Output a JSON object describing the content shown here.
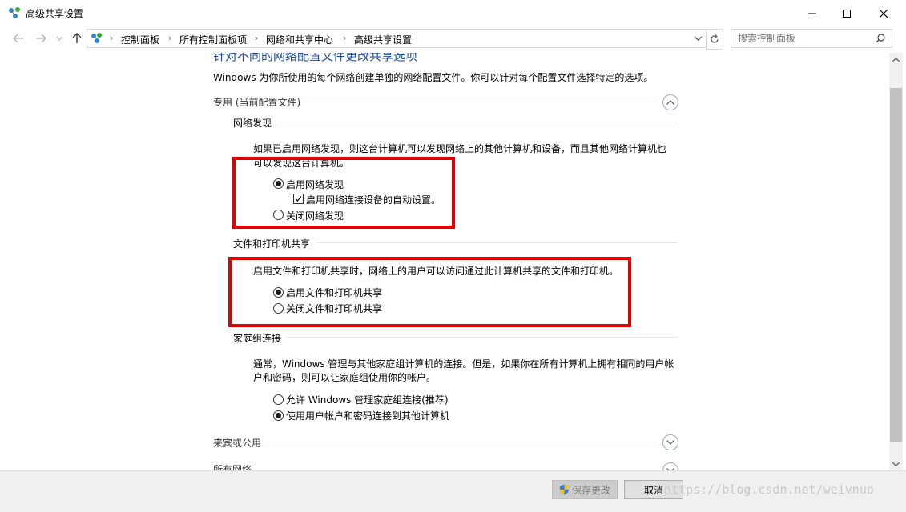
{
  "window": {
    "title": "高级共享设置",
    "minimize_icon": "minimize-icon",
    "maximize_icon": "maximize-icon",
    "close_icon": "close-icon"
  },
  "nav": {
    "breadcrumbs": [
      "控制面板",
      "所有控制面板项",
      "网络和共享中心",
      "高级共享设置"
    ],
    "search_placeholder": "搜索控制面板"
  },
  "page": {
    "heading": "针对不同的网络配置文件更改共享选项",
    "description": "Windows 为你所使用的每个网络创建单独的网络配置文件。你可以针对每个配置文件选择特定的选项。",
    "profile_private": {
      "label": "专用 (当前配置文件)",
      "expanded": true
    },
    "network_discovery": {
      "title": "网络发现",
      "desc_line1": "如果已启用网络发现，则这台计算机可以发现网络上的其他计算机和设备，而且其他网络计算机也",
      "desc_line2": "可以发现这台计算机。",
      "option_on": "启用网络发现",
      "option_auto": "启用网络连接设备的自动设置。",
      "option_off": "关闭网络发现",
      "selected": "启用网络发现",
      "auto_checked": true
    },
    "file_printer_sharing": {
      "title": "文件和打印机共享",
      "desc": "启用文件和打印机共享时，网络上的用户可以访问通过此计算机共享的文件和打印机。",
      "option_on": "启用文件和打印机共享",
      "option_off": "关闭文件和打印机共享",
      "selected": "启用文件和打印机共享"
    },
    "homegroup": {
      "title": "家庭组连接",
      "desc_line1": "通常，Windows 管理与其他家庭组计算机的连接。但是，如果你在所有计算机上拥有相同的用户帐",
      "desc_line2": "户和密码，则可以让家庭组使用你的帐户。",
      "option_allow": "允许 Windows 管理家庭组连接(推荐)",
      "option_user": "使用用户帐户和密码连接到其他计算机",
      "selected": "使用用户帐户和密码连接到其他计算机"
    },
    "profile_guest": {
      "label": "来宾或公用",
      "expanded": false
    },
    "profile_all": {
      "label": "所有网络",
      "expanded": false
    }
  },
  "footer": {
    "save_label": "保存更改",
    "cancel_label": "取消",
    "watermark": "https://blog.csdn.net/weivnuo"
  },
  "colors": {
    "highlight_border": "#e30000",
    "link_blue": "#1e4e9b"
  }
}
